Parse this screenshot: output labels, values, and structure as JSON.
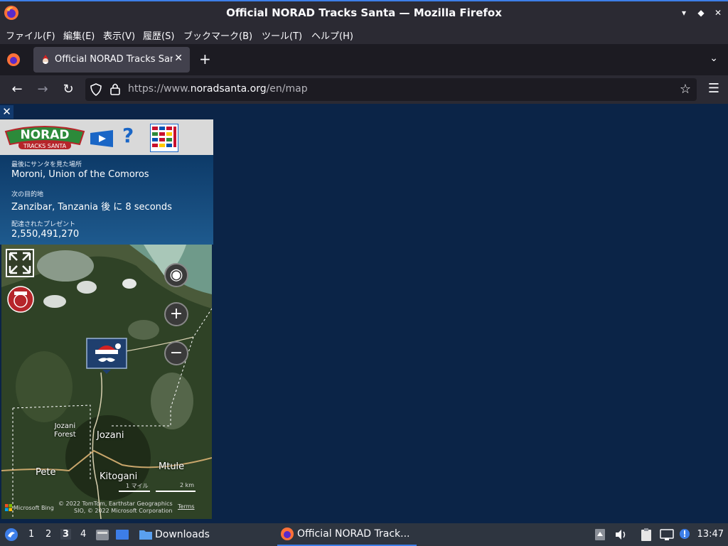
{
  "window": {
    "title": "Official NORAD Tracks Santa — Mozilla Firefox"
  },
  "menubar": {
    "items": [
      "ファイル(F)",
      "編集(E)",
      "表示(V)",
      "履歴(S)",
      "ブックマーク(B)",
      "ツール(T)",
      "ヘルプ(H)"
    ]
  },
  "tab": {
    "label": "Official NORAD Tracks Santa"
  },
  "urlbar": {
    "prefix": "https://www.",
    "domain": "noradsanta.org",
    "path": "/en/map"
  },
  "panel": {
    "last_seen_label": "最後にサンタを見た場所",
    "last_seen_value": "Moroni, Union of the Comoros",
    "next_label": "次の目的地",
    "next_value": "Zanzibar, Tanzania 後 に 8 seconds",
    "presents_label": "配達されたプレゼント",
    "presents_value": "2,550,491,270"
  },
  "map": {
    "places": {
      "jozani_forest": "Jozani\nForest",
      "jozani": "Jozani",
      "pete": "Pete",
      "kitogani": "Kitogani",
      "mtule": "Mtule"
    },
    "scale_mi": "1 マイル",
    "scale_km": "2 km",
    "bing": "Microsoft Bing",
    "copyright_1": "© 2022 TomTom, Earthstar Geographics",
    "copyright_2": "SIO, © 2022 Microsoft Corporation",
    "terms": "Terms"
  },
  "taskbar": {
    "workspaces": [
      "1",
      "2",
      "3",
      "4"
    ],
    "active_workspace": "3",
    "downloads_label": "Downloads",
    "task_label": "Official NORAD Track...",
    "clock": "13:47"
  },
  "colors": {
    "accent": "#3d7ee8",
    "page_bg": "#0b2447",
    "panel_blue": "#0d3a68"
  }
}
